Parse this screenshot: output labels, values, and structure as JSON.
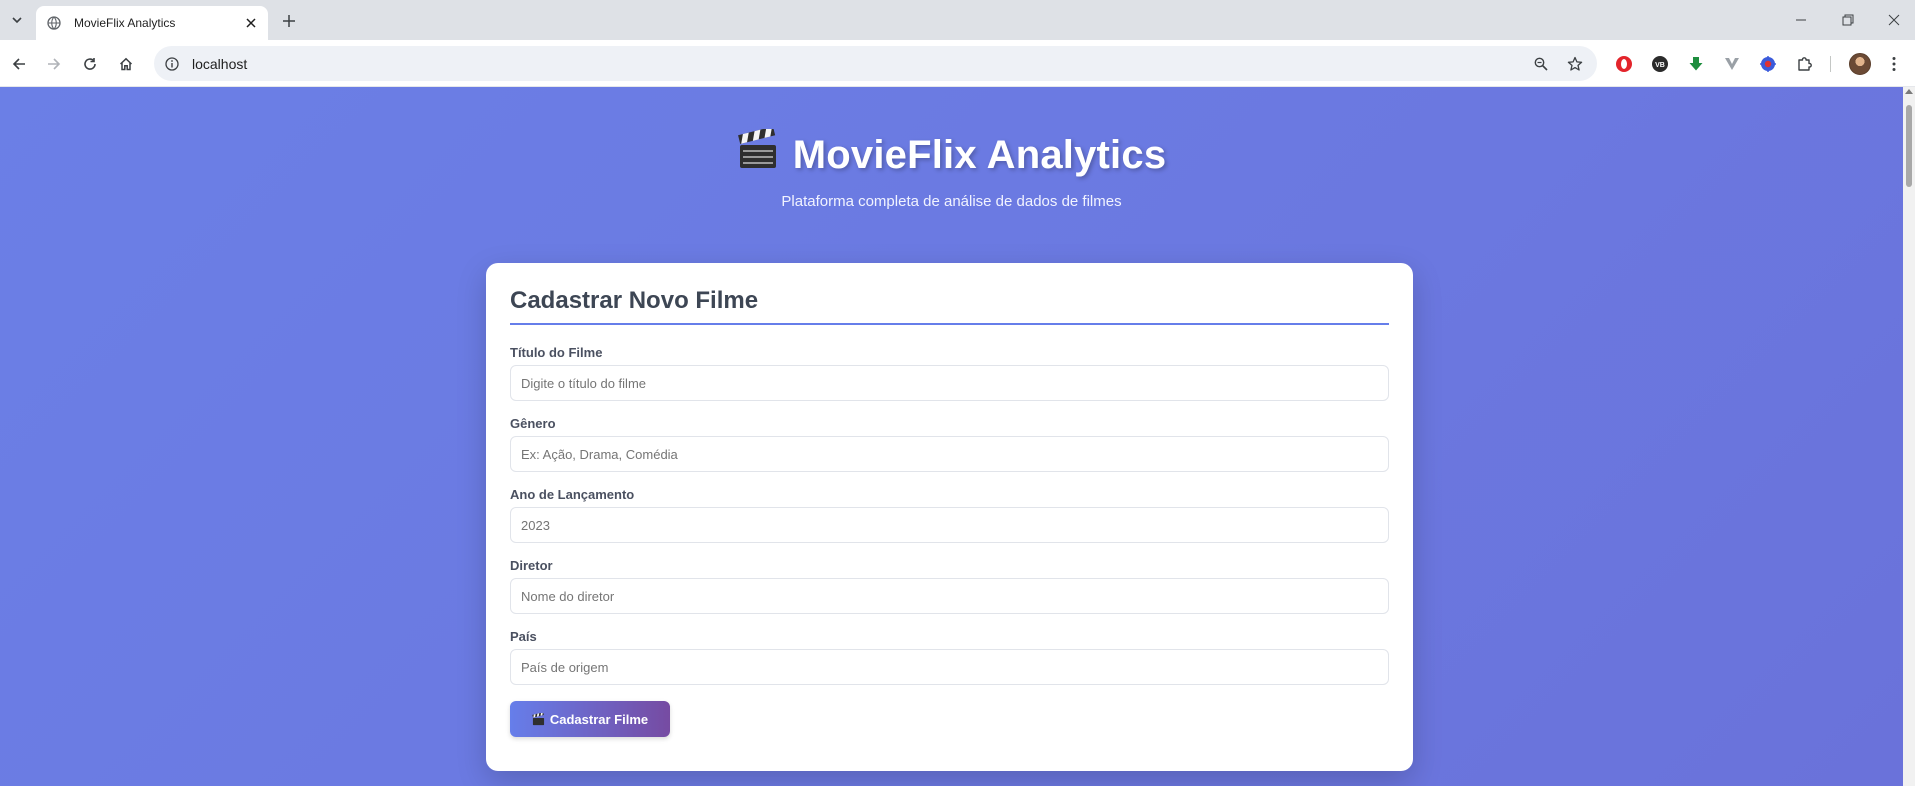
{
  "browser": {
    "tab_title": "MovieFlix Analytics",
    "url": "localhost",
    "extensions": [
      "opera-icon",
      "vpn-icon",
      "download-icon",
      "vivaldi-icon",
      "shield-bug-icon",
      "extensions-icon"
    ]
  },
  "header": {
    "title": "MovieFlix Analytics",
    "subtitle": "Plataforma completa de análise de dados de filmes"
  },
  "form": {
    "heading": "Cadastrar Novo Filme",
    "fields": [
      {
        "label": "Título do Filme",
        "placeholder": "Digite o título do filme",
        "value": ""
      },
      {
        "label": "Gênero",
        "placeholder": "Ex: Ação, Drama, Comédia",
        "value": ""
      },
      {
        "label": "Ano de Lançamento",
        "placeholder": "2023",
        "value": ""
      },
      {
        "label": "Diretor",
        "placeholder": "Nome do diretor",
        "value": ""
      },
      {
        "label": "País",
        "placeholder": "País de origem",
        "value": ""
      }
    ],
    "submit_label": "Cadastrar Filme"
  },
  "colors": {
    "background": "#6b7fe6",
    "accent": "#667eea",
    "button_gradient_end": "#764ba2"
  }
}
